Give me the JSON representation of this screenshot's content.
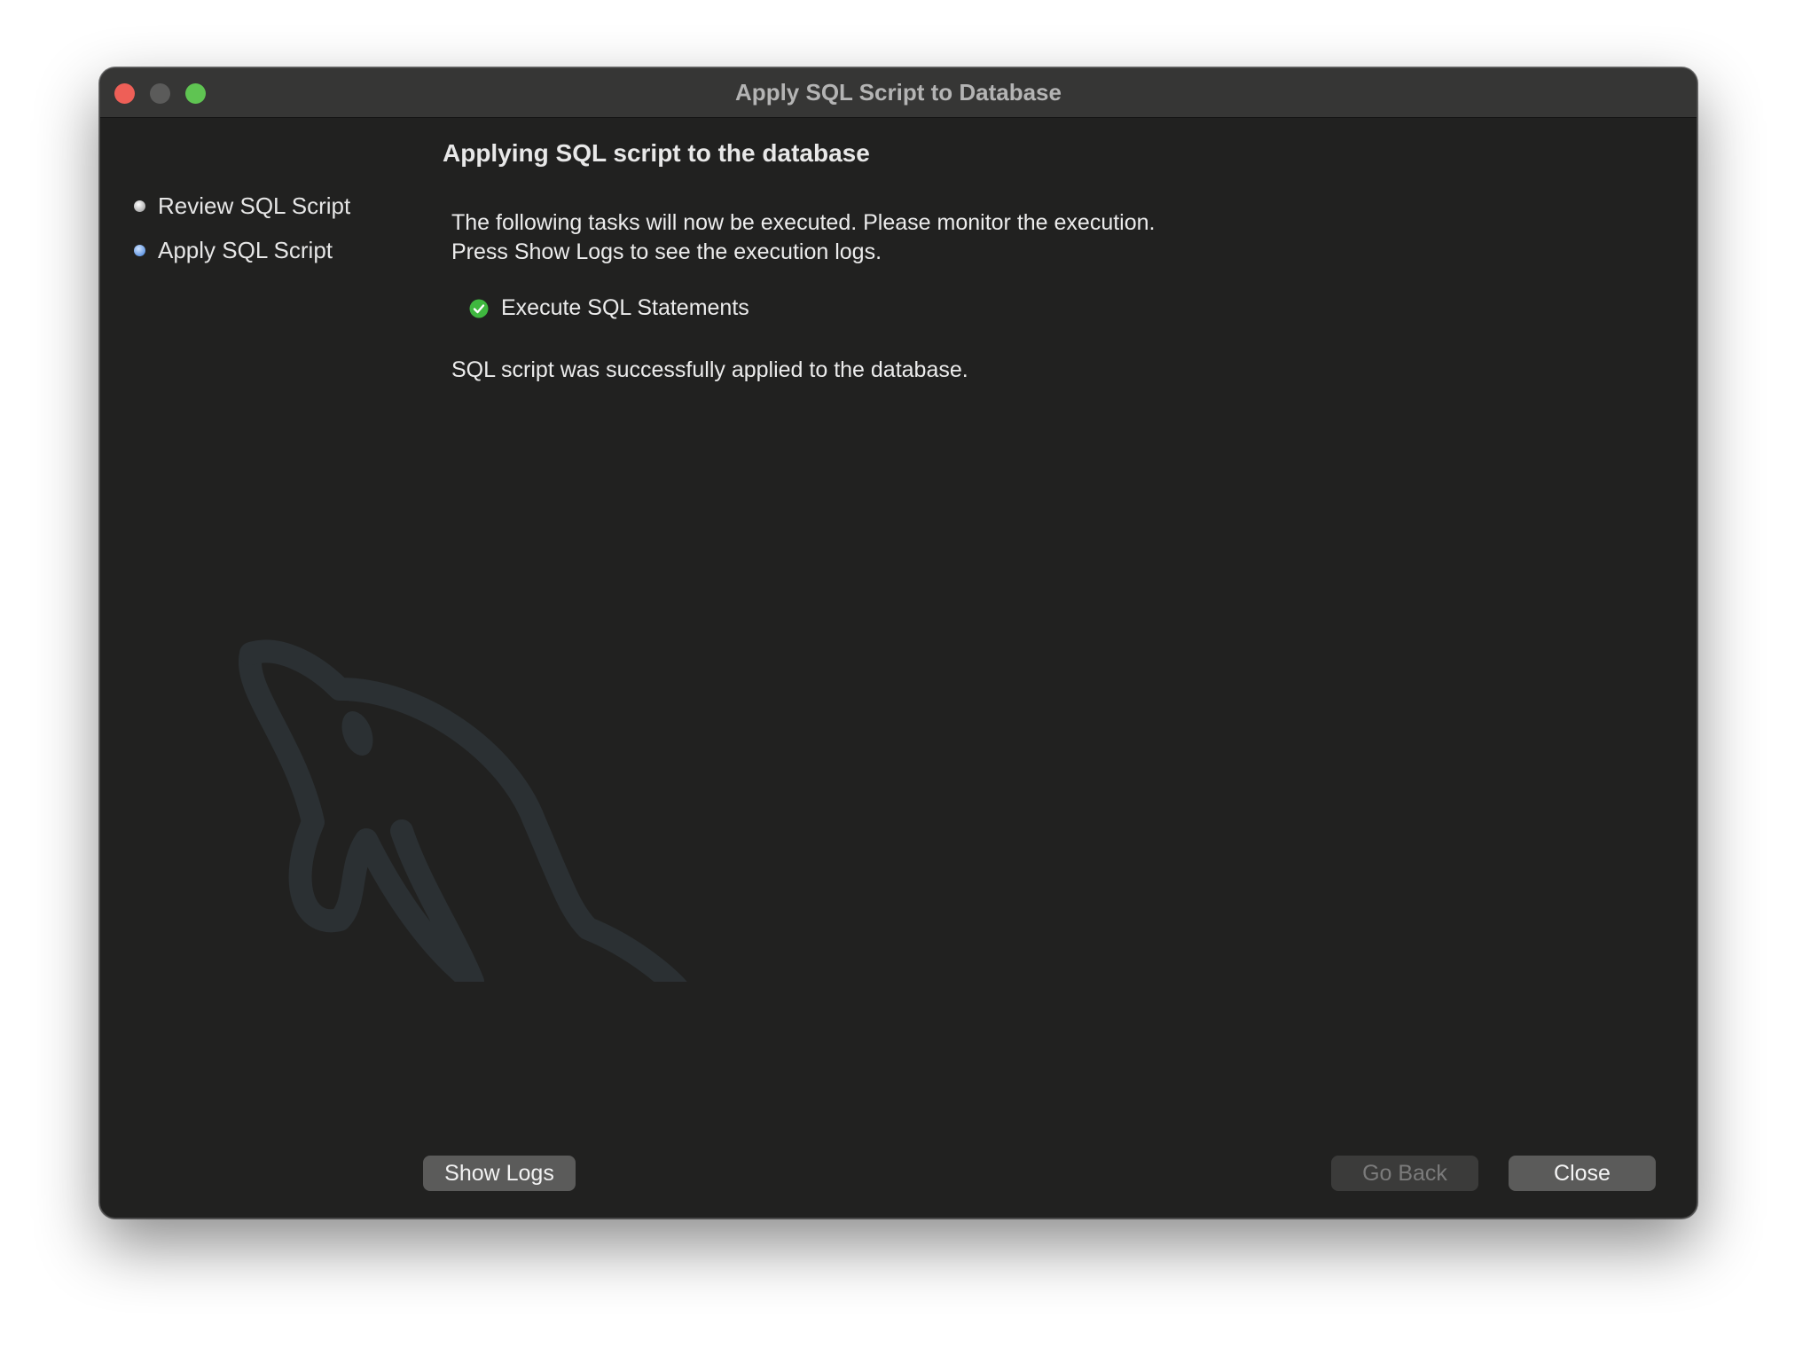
{
  "window": {
    "title": "Apply SQL Script to Database"
  },
  "steps": [
    {
      "label": "Review SQL Script",
      "state": "done"
    },
    {
      "label": "Apply SQL Script",
      "state": "current"
    }
  ],
  "main": {
    "heading": "Applying SQL script to the database",
    "description_line1": "The following tasks will now be executed. Please monitor the execution.",
    "description_line2": "Press Show Logs to see the execution logs.",
    "task_label": "Execute SQL Statements",
    "task_icon": "check-circle-icon",
    "result_text": "SQL script was successfully applied to the database."
  },
  "buttons": {
    "show_logs": "Show Logs",
    "go_back": "Go Back",
    "close": "Close"
  },
  "colors": {
    "success": "#3fb83f",
    "current_step": "#3a7bd9"
  }
}
